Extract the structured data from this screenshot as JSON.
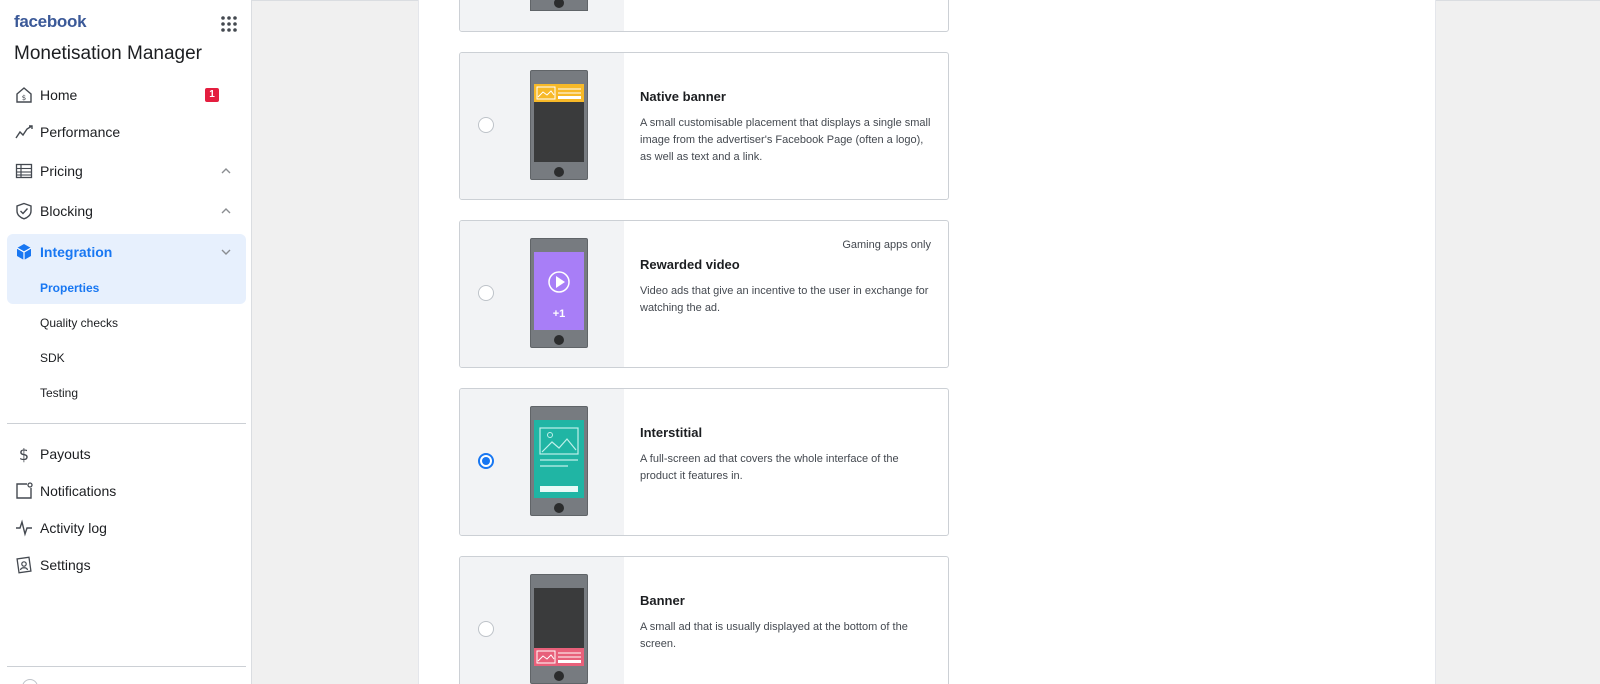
{
  "brand": "facebook",
  "app_title": "Monetisation Manager",
  "nav": {
    "home": {
      "label": "Home",
      "badge": "1"
    },
    "performance": {
      "label": "Performance"
    },
    "pricing": {
      "label": "Pricing"
    },
    "blocking": {
      "label": "Blocking"
    },
    "integration": {
      "label": "Integration"
    },
    "sub": {
      "properties": "Properties",
      "quality_checks": "Quality checks",
      "sdk": "SDK",
      "testing": "Testing"
    },
    "payouts": {
      "label": "Payouts"
    },
    "notifications": {
      "label": "Notifications"
    },
    "activity_log": {
      "label": "Activity log"
    },
    "settings": {
      "label": "Settings"
    }
  },
  "formats": [
    {
      "title": "Native banner",
      "description": "A small customisable placement that displays a single small image from the advertiser's Facebook Page (often a logo), as well as text and a link.",
      "selected": false
    },
    {
      "title": "Rewarded video",
      "description": "Video ads that give an incentive to the user in exchange for watching the ad.",
      "tag": "Gaming apps only",
      "screen_text": "+1",
      "selected": false
    },
    {
      "title": "Interstitial",
      "description": "A full-screen ad that covers the whole interface of the product it features in.",
      "selected": true
    },
    {
      "title": "Banner",
      "description": "A small ad that is usually displayed at the bottom of the screen.",
      "selected": false
    }
  ],
  "colors": {
    "accent": "#1877f2",
    "native_banner": "#f7b928",
    "rewarded_video": "#a87ef7",
    "interstitial": "#20b5a4",
    "banner": "#e8607a"
  }
}
